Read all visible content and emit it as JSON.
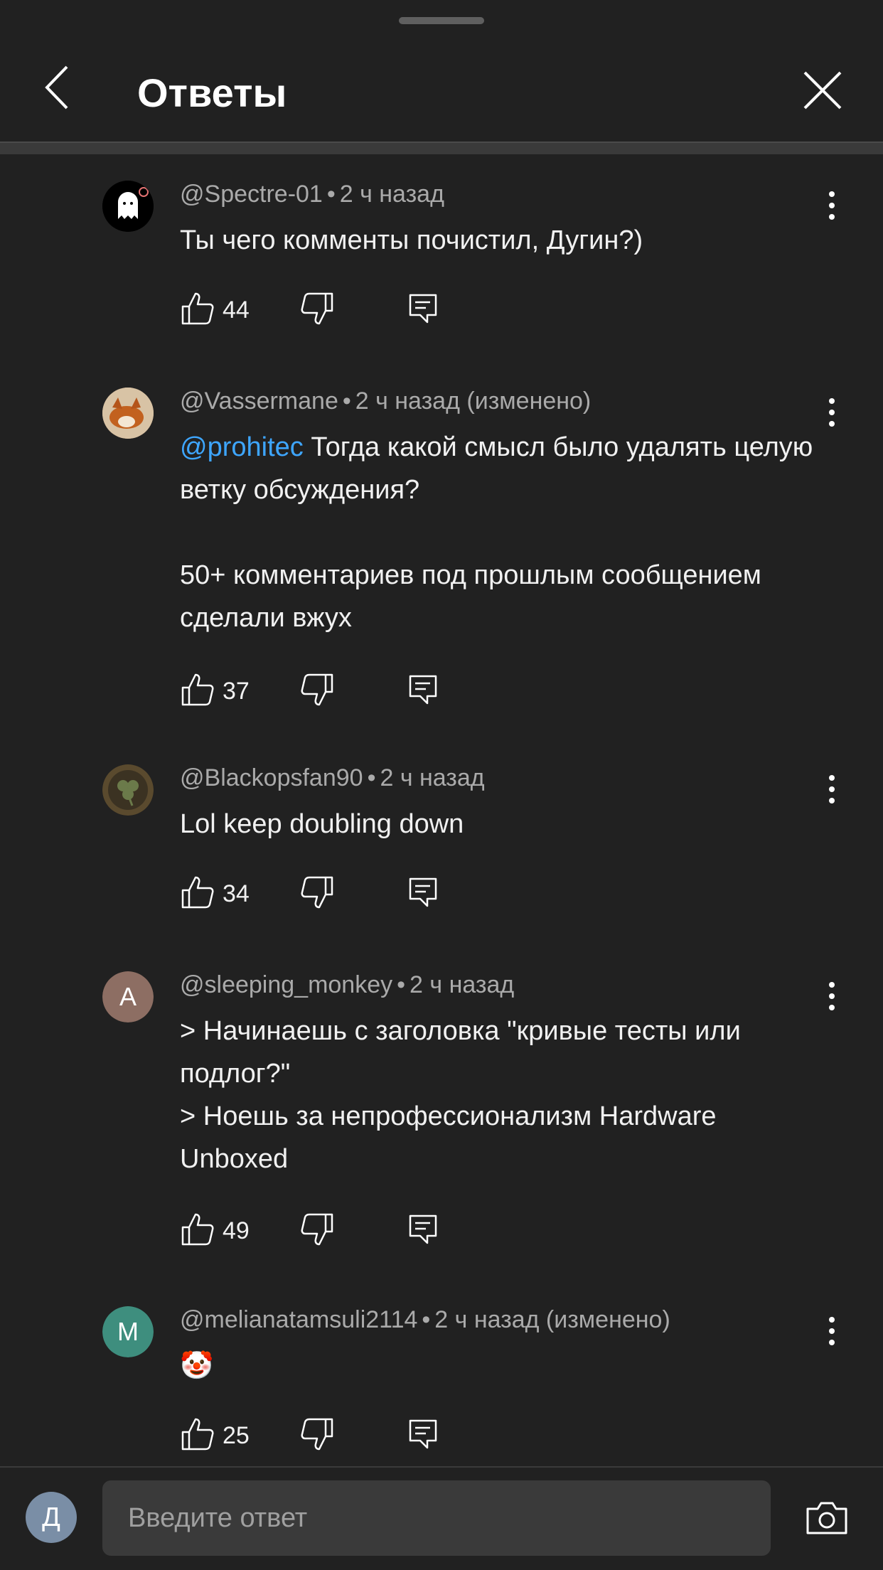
{
  "header": {
    "title": "Ответы"
  },
  "comments": [
    {
      "author": "@Spectre-01",
      "time": "2 ч назад",
      "edited": "",
      "mention": "",
      "text": "Ты чего комменты почистил, Дугин?)",
      "likes": "44"
    },
    {
      "author": "@Vassermane",
      "time": "2 ч назад",
      "edited": "(изменено)",
      "mention": "@prohitec",
      "text": " Тогда какой смысл было удалять целую ветку обсуждения?\n\n50+ комментариев под прошлым сообщением сделали вжух",
      "likes": "37"
    },
    {
      "author": "@Blackopsfan90",
      "time": "2 ч назад",
      "edited": "",
      "mention": "",
      "text": "Lol keep doubling down",
      "likes": "34"
    },
    {
      "author": "@sleeping_monkey",
      "avatar_letter": "A",
      "avatar_color": "#8d6e63",
      "time": "2 ч назад",
      "edited": "",
      "mention": "",
      "text": "> Начинаешь с заголовка \"кривые тесты или подлог?\"\n> Ноешь за непрофессионализм Hardware Unboxed",
      "likes": "49"
    },
    {
      "author": "@melianatamsuli2114",
      "avatar_letter": "M",
      "avatar_color": "#3e8e7e",
      "time": "2 ч назад",
      "edited": "(изменено)",
      "mention": "",
      "text": "🤡",
      "likes": "25"
    }
  ],
  "footer": {
    "user_avatar_letter": "Д",
    "reply_placeholder": "Введите ответ"
  },
  "icons": {
    "back": "chevron-left-icon",
    "close": "close-icon",
    "menu": "more-vertical-icon",
    "like": "thumbs-up-icon",
    "dislike": "thumbs-down-icon",
    "reply": "reply-icon",
    "camera": "camera-icon"
  }
}
